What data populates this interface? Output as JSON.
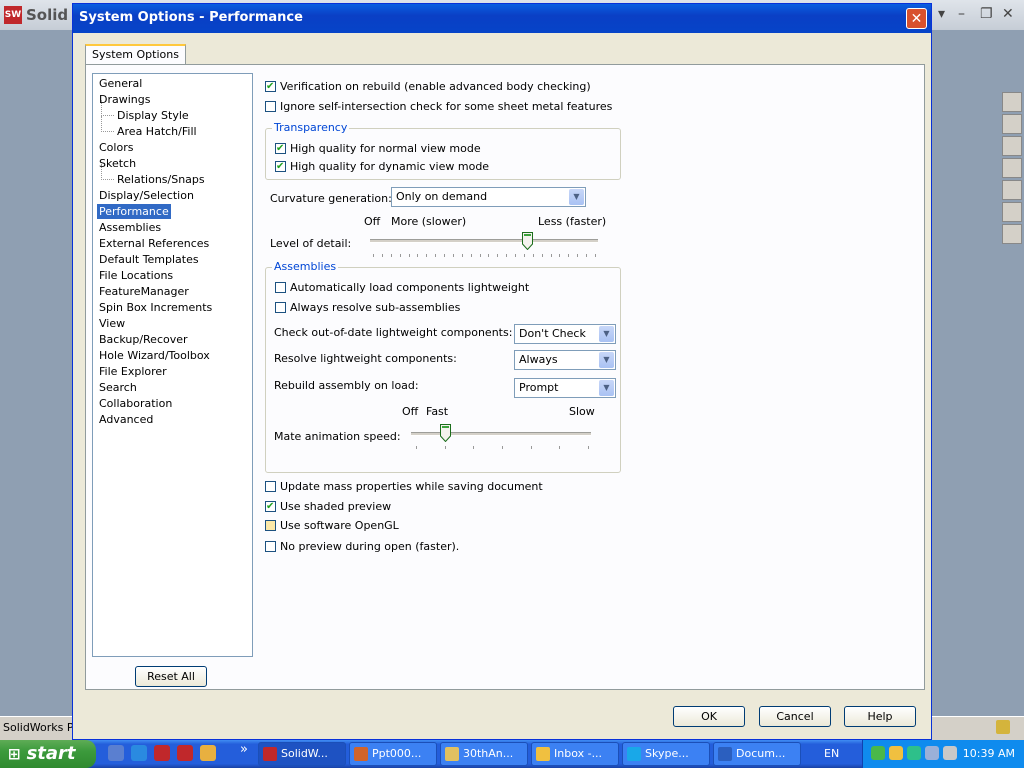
{
  "app": {
    "title": "Solid",
    "logo": "SW",
    "status_text": "SolidWorks Pre",
    "side_icons": [
      "home-icon",
      "resources-icon",
      "folder-icon",
      "view-palette-icon",
      "design-library-icon",
      "appearance-icon",
      "properties-icon"
    ]
  },
  "dialog": {
    "title": "System Options - Performance",
    "close_glyph": "✕",
    "tab": "System Options",
    "tree": [
      {
        "label": "General",
        "level": 0
      },
      {
        "label": "Drawings",
        "level": 0
      },
      {
        "label": "Display Style",
        "level": 1
      },
      {
        "label": "Area Hatch/Fill",
        "level": 1
      },
      {
        "label": "Colors",
        "level": 0
      },
      {
        "label": "Sketch",
        "level": 0
      },
      {
        "label": "Relations/Snaps",
        "level": 1
      },
      {
        "label": "Display/Selection",
        "level": 0
      },
      {
        "label": "Performance",
        "level": 0,
        "selected": true
      },
      {
        "label": "Assemblies",
        "level": 0
      },
      {
        "label": "External References",
        "level": 0
      },
      {
        "label": "Default Templates",
        "level": 0
      },
      {
        "label": "File Locations",
        "level": 0
      },
      {
        "label": "FeatureManager",
        "level": 0
      },
      {
        "label": "Spin Box Increments",
        "level": 0
      },
      {
        "label": "View",
        "level": 0
      },
      {
        "label": "Backup/Recover",
        "level": 0
      },
      {
        "label": "Hole Wizard/Toolbox",
        "level": 0
      },
      {
        "label": "File Explorer",
        "level": 0
      },
      {
        "label": "Search",
        "level": 0
      },
      {
        "label": "Collaboration",
        "level": 0
      },
      {
        "label": "Advanced",
        "level": 0
      }
    ],
    "reset_label": "Reset All",
    "performance": {
      "verify_rebuild": {
        "label": "Verification on rebuild (enable advanced body checking)",
        "checked": true
      },
      "ignore_self_intersection": {
        "label": "Ignore self-intersection check for some sheet metal features",
        "checked": false
      },
      "transparency": {
        "title": "Transparency",
        "normal": {
          "label": "High quality for normal view mode",
          "checked": true
        },
        "dynamic": {
          "label": "High quality for dynamic view mode",
          "checked": true
        }
      },
      "curvature": {
        "label": "Curvature generation:",
        "value": "Only on demand"
      },
      "level_of_detail": {
        "label": "Level of detail:",
        "off": "Off",
        "more": "More (slower)",
        "less": "Less (faster)",
        "slider_value": 0.69
      },
      "assemblies": {
        "title": "Assemblies",
        "auto_lightweight": {
          "label": "Automatically load components lightweight",
          "checked": false
        },
        "resolve_sub": {
          "label": "Always resolve sub-assemblies",
          "checked": false
        },
        "check_out_of_date": {
          "label": "Check out-of-date lightweight components:",
          "value": "Don't Check"
        },
        "resolve_lightweight": {
          "label": "Resolve lightweight components:",
          "value": "Always"
        },
        "rebuild_on_load": {
          "label": "Rebuild assembly on load:",
          "value": "Prompt"
        },
        "mate_animation": {
          "label": "Mate animation speed:",
          "off": "Off",
          "fast": "Fast",
          "slow": "Slow",
          "slider_value": 0.19
        }
      },
      "update_mass": {
        "label": "Update mass properties while saving document",
        "checked": false
      },
      "shaded_preview": {
        "label": "Use shaded preview",
        "checked": true
      },
      "software_opengl": {
        "label": "Use software OpenGL",
        "checked": false
      },
      "no_preview": {
        "label": "No preview during open (faster).",
        "checked": false
      }
    },
    "buttons": {
      "ok": "OK",
      "cancel": "Cancel",
      "help": "Help"
    }
  },
  "taskbar": {
    "start_label": "start",
    "start_glyph": "⊞",
    "overflow_glyph": "»",
    "tasks": [
      {
        "label": "SolidW...",
        "active": true,
        "icon_color": "#c0282b"
      },
      {
        "label": "Ppt000...",
        "active": false,
        "icon_color": "#d0642a"
      },
      {
        "label": "30thAn...",
        "active": false,
        "icon_color": "#e0c060"
      },
      {
        "label": "Inbox -...",
        "active": false,
        "icon_color": "#f0c040"
      },
      {
        "label": "Skype...",
        "active": false,
        "icon_color": "#19a8e8"
      },
      {
        "label": "Docum...",
        "active": false,
        "icon_color": "#2b5fbf"
      }
    ],
    "language": "EN",
    "clock": "10:39 AM"
  }
}
